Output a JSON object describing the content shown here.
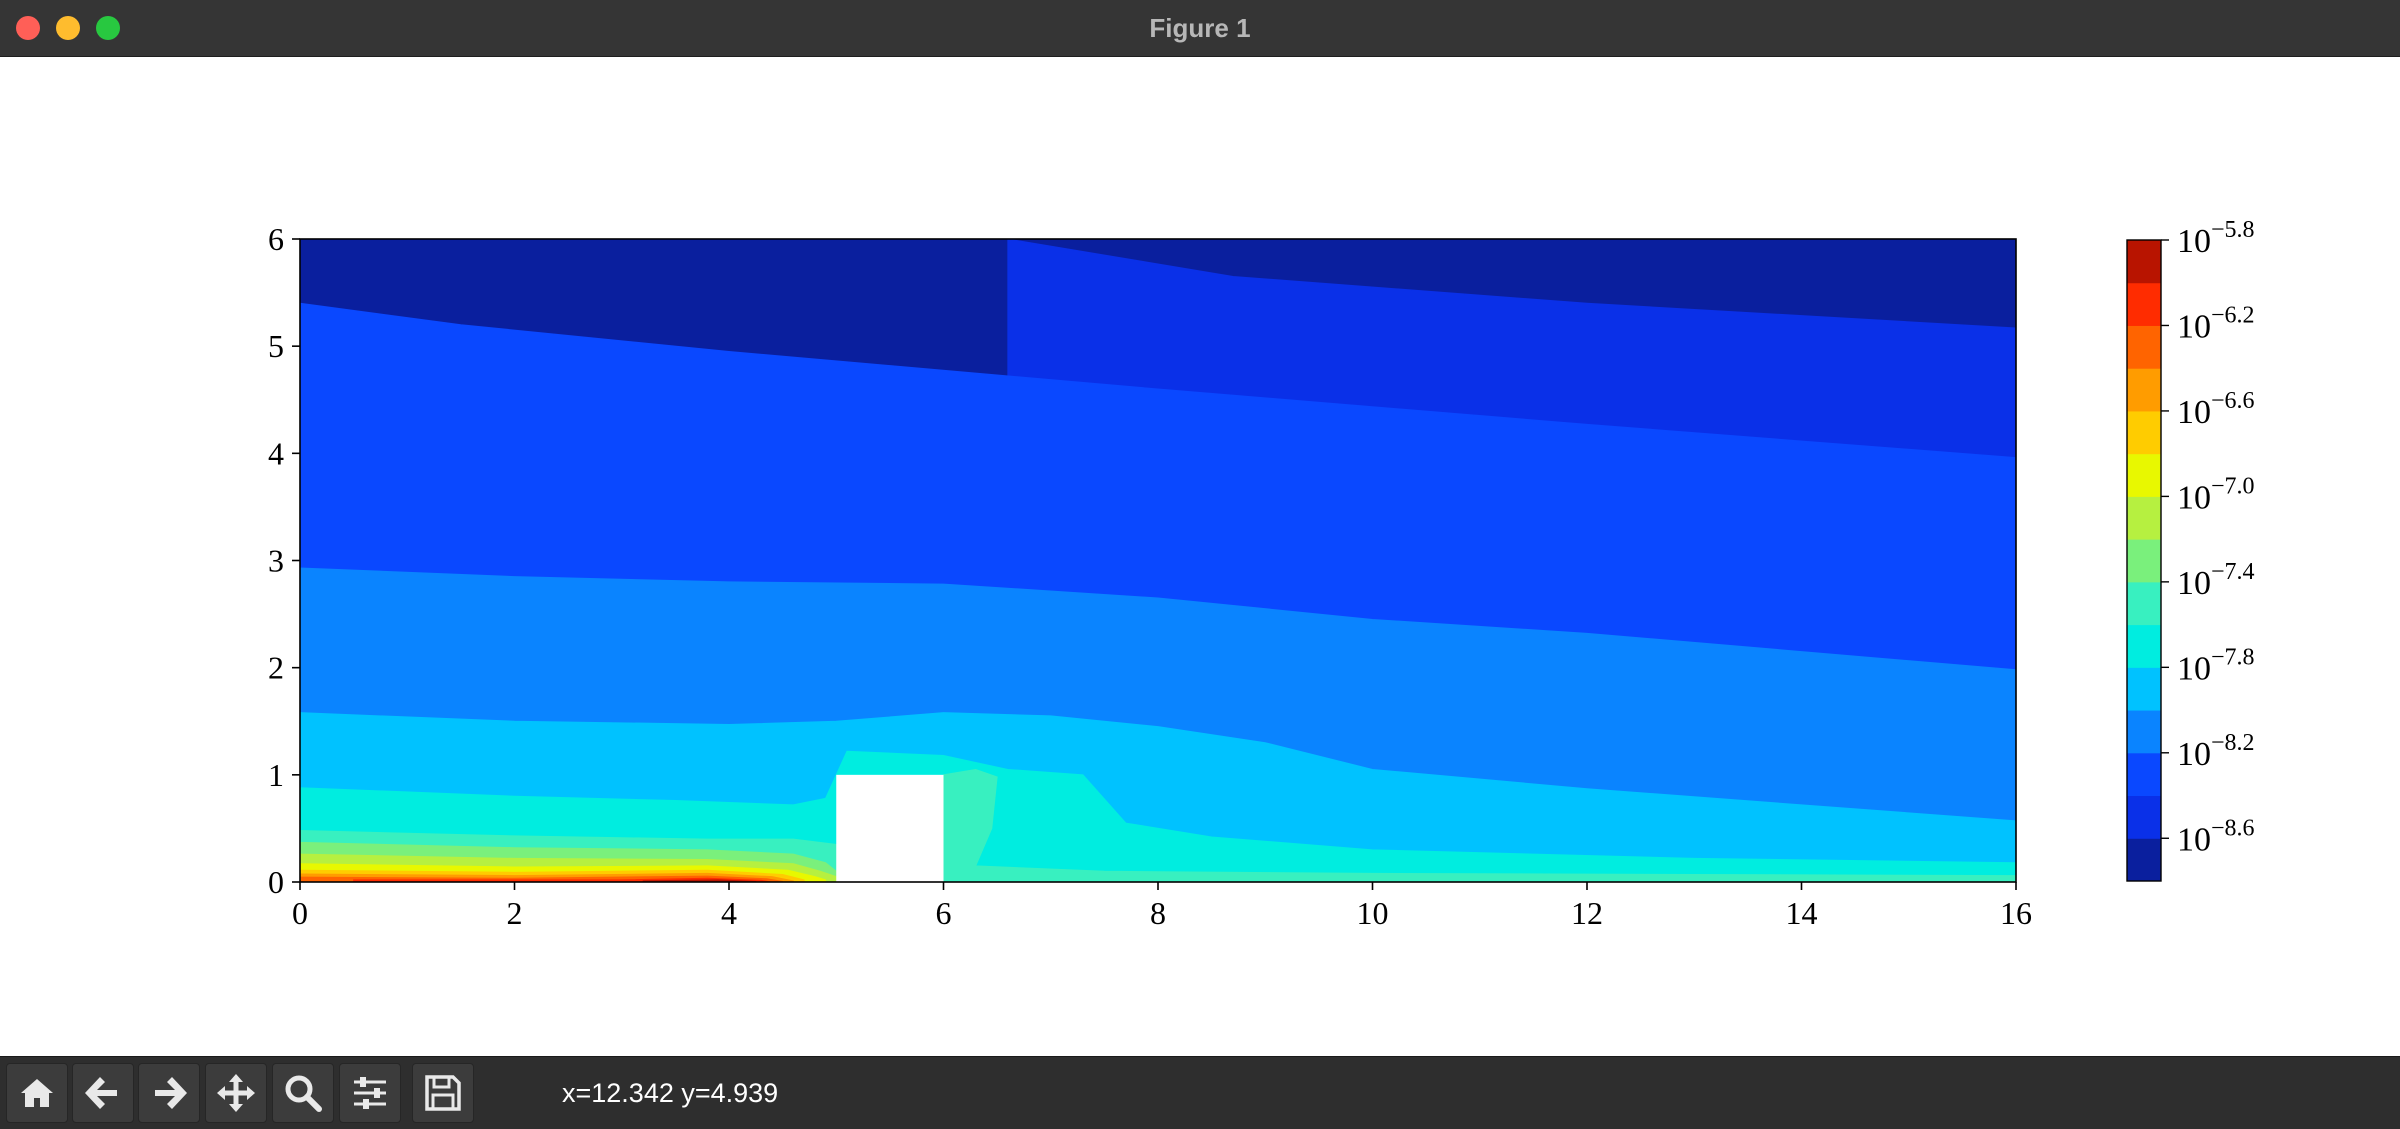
{
  "window": {
    "title": "Figure 1"
  },
  "toolbar": {
    "buttons": [
      {
        "name": "home",
        "icon": "home-icon"
      },
      {
        "name": "back",
        "icon": "arrow-left-icon"
      },
      {
        "name": "forward",
        "icon": "arrow-right-icon"
      },
      {
        "name": "pan",
        "icon": "move-icon"
      },
      {
        "name": "zoom",
        "icon": "magnifier-icon"
      },
      {
        "name": "configure-subplots",
        "icon": "sliders-icon"
      },
      {
        "name": "save",
        "icon": "floppy-disk-icon"
      }
    ],
    "coords": "x=12.342 y=4.939"
  },
  "chart_data": {
    "type": "heatmap",
    "subtype": "filled-contour",
    "title": "",
    "xlabel": "",
    "ylabel": "",
    "xlim": [
      0,
      16
    ],
    "ylim": [
      0,
      6
    ],
    "x_ticks": [
      "0",
      "2",
      "4",
      "6",
      "8",
      "10",
      "12",
      "14",
      "16"
    ],
    "y_ticks": [
      "0",
      "1",
      "2",
      "3",
      "4",
      "5",
      "6"
    ],
    "obstacle": {
      "x": [
        5,
        6
      ],
      "y": [
        0,
        1
      ]
    },
    "colormap": "jet",
    "colorbar": {
      "scale": "log",
      "min_exponent": -8.8,
      "max_exponent": -5.8,
      "tick_base": "10",
      "tick_exponents": [
        "−5.8",
        "−6.2",
        "−6.6",
        "−7.0",
        "−7.4",
        "−7.8",
        "−8.2",
        "−8.6"
      ],
      "levels": [
        "#0a1f9e",
        "#0a30e8",
        "#0a48ff",
        "#0a84ff",
        "#00c2ff",
        "#00ede0",
        "#38f0c0",
        "#7af07c",
        "#b6f040",
        "#e8f800",
        "#ffcc00",
        "#ff9c00",
        "#ff6400",
        "#ff2c00",
        "#b81400"
      ]
    },
    "contour_boundaries": [
      {
        "level_above": 0,
        "points": [
          [
            6.6,
            6
          ],
          [
            8.7,
            5.65
          ],
          [
            12,
            5.4
          ],
          [
            16,
            5.17
          ]
        ]
      },
      {
        "level_above": 1,
        "points": [
          [
            0,
            5.4
          ],
          [
            1.5,
            5.2
          ],
          [
            4,
            4.95
          ],
          [
            8,
            4.6
          ],
          [
            12,
            4.27
          ],
          [
            16,
            3.96
          ]
        ]
      },
      {
        "level_above": 2,
        "points": [
          [
            0,
            2.93
          ],
          [
            2,
            2.85
          ],
          [
            4,
            2.8
          ],
          [
            6,
            2.78
          ],
          [
            8,
            2.65
          ],
          [
            10,
            2.45
          ],
          [
            12,
            2.32
          ],
          [
            14,
            2.15
          ],
          [
            16,
            1.98
          ]
        ]
      },
      {
        "level_above": 3,
        "points": [
          [
            0,
            1.58
          ],
          [
            2,
            1.5
          ],
          [
            4,
            1.47
          ],
          [
            5,
            1.5
          ],
          [
            6,
            1.58
          ],
          [
            7,
            1.55
          ],
          [
            8,
            1.45
          ],
          [
            9,
            1.3
          ],
          [
            10,
            1.05
          ],
          [
            12,
            0.87
          ],
          [
            14,
            0.72
          ],
          [
            16,
            0.57
          ]
        ]
      },
      {
        "level_above": 4,
        "points": [
          [
            0,
            0.88
          ],
          [
            2,
            0.8
          ],
          [
            3.5,
            0.76
          ],
          [
            4.6,
            0.72
          ],
          [
            4.9,
            0.78
          ],
          [
            5,
            1.0
          ],
          [
            5.1,
            1.22
          ],
          [
            6.0,
            1.18
          ],
          [
            6.6,
            1.05
          ],
          [
            7.3,
            1.0
          ],
          [
            7.7,
            0.55
          ],
          [
            8.5,
            0.42
          ],
          [
            10,
            0.3
          ],
          [
            13,
            0.22
          ],
          [
            16,
            0.18
          ]
        ]
      },
      {
        "level_above": 5,
        "points": [
          [
            0,
            0.48
          ],
          [
            2,
            0.43
          ],
          [
            3.8,
            0.4
          ],
          [
            4.6,
            0.4
          ],
          [
            5,
            0.35
          ],
          [
            5,
            0
          ],
          [
            6,
            0
          ],
          [
            6,
            1.0
          ],
          [
            6.3,
            1.05
          ],
          [
            6.5,
            0.98
          ],
          [
            6.45,
            0.5
          ],
          [
            6.3,
            0.15
          ],
          [
            7.5,
            0.1
          ],
          [
            10,
            0.08
          ],
          [
            16,
            0.06
          ]
        ]
      },
      {
        "level_above": 6,
        "points": [
          [
            0,
            0.37
          ],
          [
            2,
            0.32
          ],
          [
            3.8,
            0.3
          ],
          [
            4.6,
            0.26
          ],
          [
            4.9,
            0.18
          ],
          [
            5,
            0.1
          ]
        ]
      },
      {
        "level_above": 7,
        "points": [
          [
            0,
            0.26
          ],
          [
            2,
            0.22
          ],
          [
            3.8,
            0.21
          ],
          [
            4.6,
            0.17
          ],
          [
            4.85,
            0.1
          ],
          [
            5,
            0.05
          ]
        ]
      },
      {
        "level_above": 8,
        "points": [
          [
            0,
            0.17
          ],
          [
            2,
            0.14
          ],
          [
            3.8,
            0.15
          ],
          [
            4.55,
            0.11
          ],
          [
            4.8,
            0.05
          ],
          [
            4.9,
            0.02
          ]
        ]
      },
      {
        "level_above": 9,
        "points": [
          [
            0,
            0.11
          ],
          [
            2,
            0.09
          ],
          [
            3.8,
            0.11
          ],
          [
            4.5,
            0.07
          ],
          [
            4.7,
            0.02
          ]
        ]
      },
      {
        "level_above": 10,
        "points": [
          [
            0,
            0.075
          ],
          [
            2,
            0.06
          ],
          [
            3.8,
            0.08
          ],
          [
            4.4,
            0.05
          ],
          [
            4.6,
            0.01
          ]
        ]
      },
      {
        "level_above": 11,
        "points": [
          [
            0,
            0.045
          ],
          [
            2,
            0.035
          ],
          [
            3.8,
            0.055
          ],
          [
            4.35,
            0.03
          ],
          [
            4.5,
            0.005
          ]
        ]
      },
      {
        "level_above": 12,
        "points": [
          [
            0.5,
            0.02
          ],
          [
            3,
            0.02
          ],
          [
            3.8,
            0.035
          ],
          [
            4.3,
            0.015
          ],
          [
            4.4,
            0
          ]
        ]
      },
      {
        "level_above": 13,
        "points": [
          [
            3.2,
            0.01
          ],
          [
            3.9,
            0.02
          ],
          [
            4.25,
            0.005
          ]
        ]
      }
    ]
  }
}
